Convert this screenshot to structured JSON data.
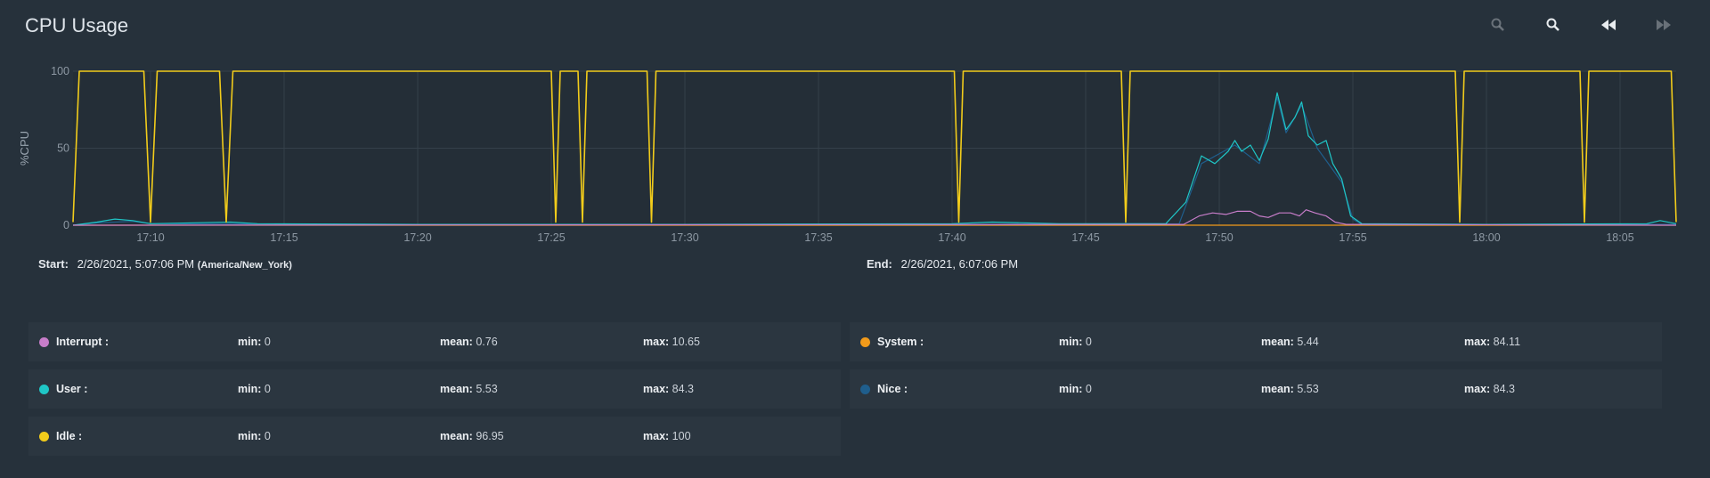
{
  "panel": {
    "title": "CPU Usage"
  },
  "toolbar": {
    "icons": [
      "zoom-out-icon",
      "zoom-in-icon",
      "rewind-icon",
      "fast-forward-icon"
    ]
  },
  "range": {
    "start_label": "Start:",
    "start_value": "2/26/2021, 5:07:06 PM",
    "timezone": "(America/New_York)",
    "end_label": "End:",
    "end_value": "2/26/2021, 6:07:06 PM"
  },
  "legend": {
    "min_label": "min:",
    "mean_label": "mean:",
    "max_label": "max:",
    "items": [
      {
        "name": "Interrupt :",
        "color": "#c77dc9",
        "min": "0",
        "mean": "0.76",
        "max": "10.65"
      },
      {
        "name": "System :",
        "color": "#f29b1b",
        "min": "0",
        "mean": "5.44",
        "max": "84.11"
      },
      {
        "name": "User :",
        "color": "#1fc6c6",
        "min": "0",
        "mean": "5.53",
        "max": "84.3"
      },
      {
        "name": "Nice :",
        "color": "#1f5e8c",
        "min": "0",
        "mean": "5.53",
        "max": "84.3"
      },
      {
        "name": "Idle :",
        "color": "#f2cc1b",
        "min": "0",
        "mean": "96.95",
        "max": "100"
      }
    ]
  },
  "chart_data": {
    "type": "line",
    "ylabel": "%CPU",
    "ylim": [
      0,
      100
    ],
    "yticks": [
      0,
      50,
      100
    ],
    "xlim": [
      "17:07:06",
      "18:07:06"
    ],
    "xticks": [
      "17:10",
      "17:15",
      "17:20",
      "17:25",
      "17:30",
      "17:35",
      "17:40",
      "17:45",
      "17:50",
      "17:55",
      "18:00",
      "18:05"
    ],
    "grid": true,
    "series": [
      {
        "name": "Idle",
        "color": "#f2cc1b",
        "points": [
          [
            "17:07:06",
            2
          ],
          [
            "17:07:20",
            100
          ],
          [
            "17:09:45",
            100
          ],
          [
            "17:10:00",
            2
          ],
          [
            "17:10:15",
            100
          ],
          [
            "17:12:35",
            100
          ],
          [
            "17:12:50",
            2
          ],
          [
            "17:13:05",
            100
          ],
          [
            "17:25:00",
            100
          ],
          [
            "17:25:10",
            2
          ],
          [
            "17:25:20",
            100
          ],
          [
            "17:26:00",
            100
          ],
          [
            "17:26:10",
            2
          ],
          [
            "17:26:20",
            100
          ],
          [
            "17:28:35",
            100
          ],
          [
            "17:28:45",
            2
          ],
          [
            "17:28:55",
            100
          ],
          [
            "17:40:05",
            100
          ],
          [
            "17:40:15",
            2
          ],
          [
            "17:40:25",
            100
          ],
          [
            "17:46:20",
            100
          ],
          [
            "17:46:30",
            2
          ],
          [
            "17:46:40",
            100
          ],
          [
            "17:58:50",
            100
          ],
          [
            "17:59:00",
            2
          ],
          [
            "17:59:10",
            100
          ],
          [
            "18:03:30",
            100
          ],
          [
            "18:03:40",
            2
          ],
          [
            "18:03:50",
            100
          ],
          [
            "18:06:55",
            100
          ],
          [
            "18:07:06",
            2
          ]
        ]
      },
      {
        "name": "User",
        "color": "#1fc6c6",
        "points": [
          [
            "17:07:06",
            0
          ],
          [
            "17:08:00",
            2
          ],
          [
            "17:08:40",
            4
          ],
          [
            "17:09:20",
            3
          ],
          [
            "17:10:00",
            1
          ],
          [
            "17:13:00",
            2
          ],
          [
            "17:14:00",
            1
          ],
          [
            "17:20:00",
            0.5
          ],
          [
            "17:30:00",
            0.5
          ],
          [
            "17:40:00",
            1
          ],
          [
            "17:41:30",
            2
          ],
          [
            "17:44:00",
            1
          ],
          [
            "17:48:00",
            1
          ],
          [
            "17:48:45",
            15
          ],
          [
            "17:49:20",
            45
          ],
          [
            "17:49:50",
            40
          ],
          [
            "17:50:20",
            48
          ],
          [
            "17:50:35",
            55
          ],
          [
            "17:50:50",
            48
          ],
          [
            "17:51:10",
            52
          ],
          [
            "17:51:30",
            42
          ],
          [
            "17:51:50",
            56
          ],
          [
            "17:52:10",
            86
          ],
          [
            "17:52:30",
            62
          ],
          [
            "17:52:50",
            70
          ],
          [
            "17:53:05",
            80
          ],
          [
            "17:53:20",
            58
          ],
          [
            "17:53:40",
            52
          ],
          [
            "17:54:00",
            55
          ],
          [
            "17:54:15",
            40
          ],
          [
            "17:54:35",
            30
          ],
          [
            "17:54:55",
            6
          ],
          [
            "17:55:20",
            1
          ],
          [
            "18:00:00",
            0.5
          ],
          [
            "18:06:00",
            1
          ],
          [
            "18:06:30",
            3
          ],
          [
            "18:07:06",
            1
          ]
        ]
      },
      {
        "name": "Nice",
        "color": "#1f5e8c",
        "points": [
          [
            "17:07:06",
            0
          ],
          [
            "17:08:00",
            1.5
          ],
          [
            "17:09:20",
            2.5
          ],
          [
            "17:10:00",
            1
          ],
          [
            "17:20:00",
            0.5
          ],
          [
            "17:40:00",
            0.5
          ],
          [
            "17:48:30",
            1
          ],
          [
            "17:49:20",
            40
          ],
          [
            "17:50:35",
            52
          ],
          [
            "17:51:30",
            40
          ],
          [
            "17:52:10",
            83
          ],
          [
            "17:52:30",
            60
          ],
          [
            "17:53:05",
            78
          ],
          [
            "17:53:40",
            50
          ],
          [
            "17:54:35",
            28
          ],
          [
            "17:55:00",
            4
          ],
          [
            "17:55:20",
            0.5
          ],
          [
            "18:07:06",
            0.5
          ]
        ]
      },
      {
        "name": "Interrupt",
        "color": "#c77dc9",
        "points": [
          [
            "17:07:06",
            0
          ],
          [
            "17:48:40",
            0.5
          ],
          [
            "17:49:15",
            6
          ],
          [
            "17:49:45",
            8
          ],
          [
            "17:50:15",
            7
          ],
          [
            "17:50:40",
            9
          ],
          [
            "17:51:10",
            9
          ],
          [
            "17:51:30",
            6
          ],
          [
            "17:51:50",
            5
          ],
          [
            "17:52:15",
            8
          ],
          [
            "17:52:40",
            8
          ],
          [
            "17:53:00",
            6
          ],
          [
            "17:53:15",
            10
          ],
          [
            "17:53:35",
            8
          ],
          [
            "17:54:00",
            6
          ],
          [
            "17:54:20",
            2
          ],
          [
            "17:54:45",
            0.5
          ],
          [
            "18:07:06",
            0
          ]
        ]
      },
      {
        "name": "System",
        "color": "#f29b1b",
        "points": [
          [
            "17:07:06",
            0
          ],
          [
            "18:07:06",
            0
          ]
        ]
      }
    ]
  }
}
